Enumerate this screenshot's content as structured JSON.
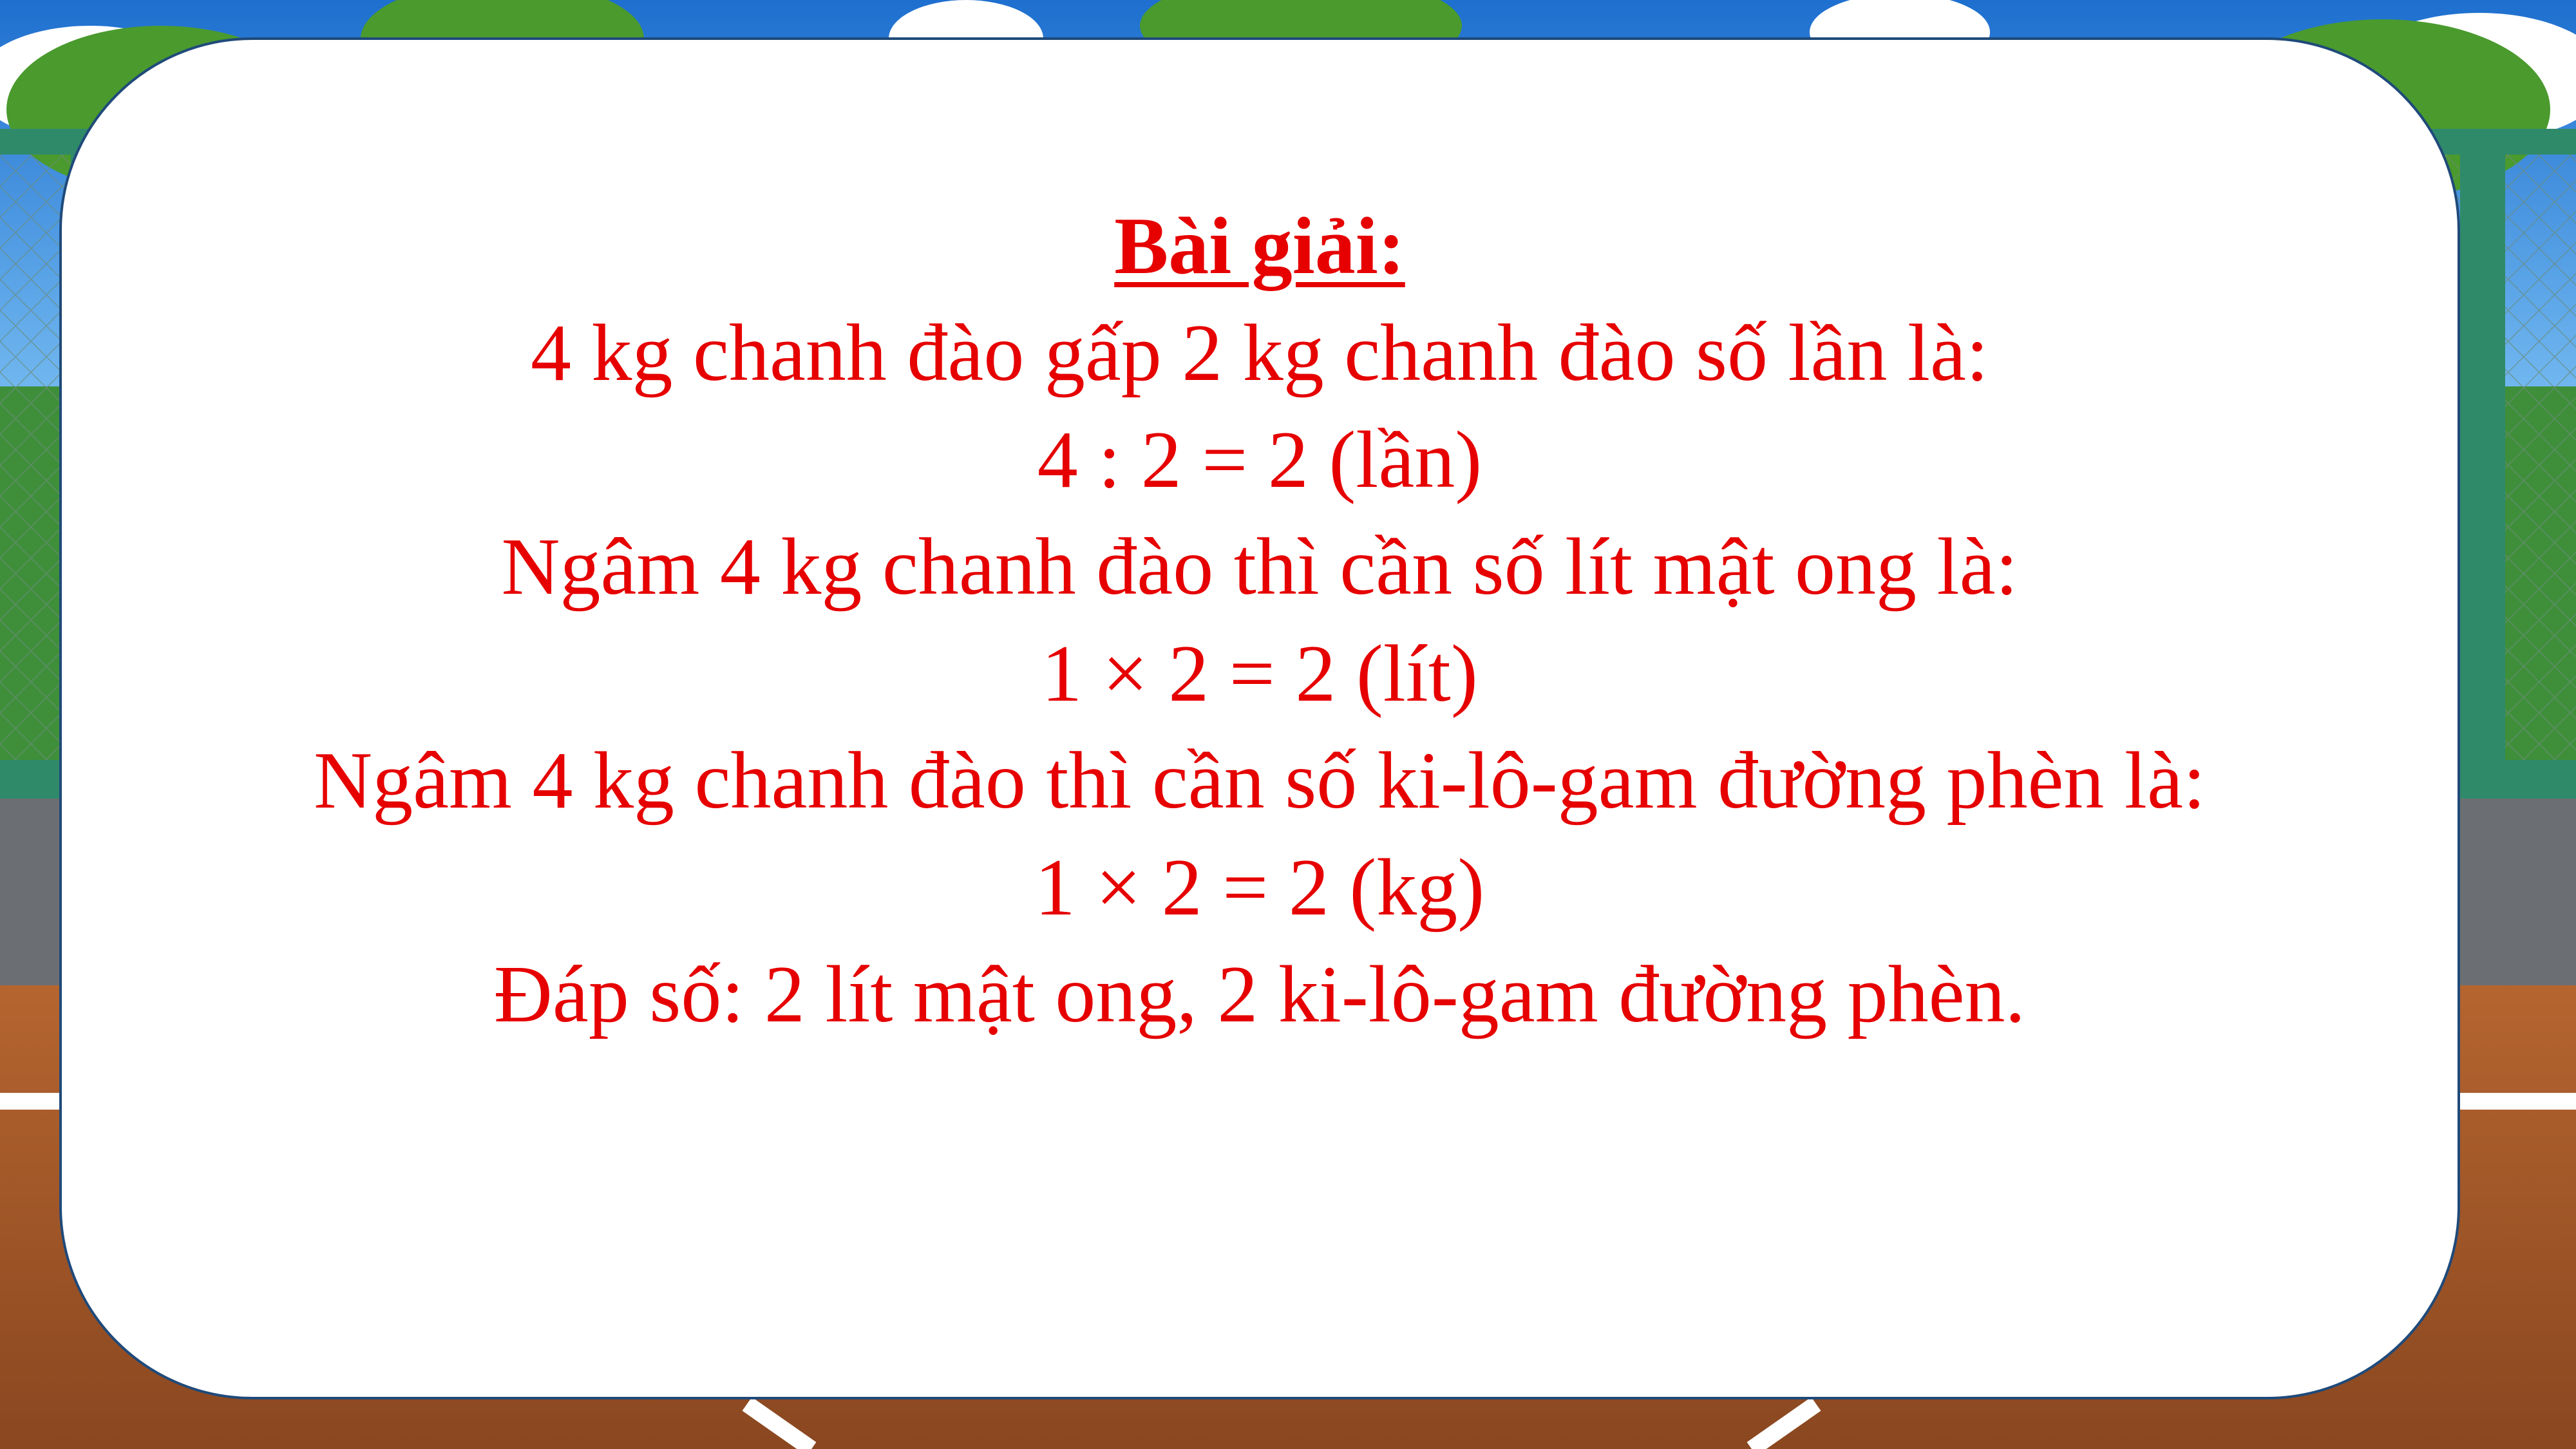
{
  "solution": {
    "heading": "Bài giải:",
    "lines": [
      "4 kg chanh đào gấp 2 kg chanh đào số lần là:",
      "4 : 2 = 2 (lần)",
      "Ngâm 4 kg chanh đào thì cần số lít mật ong là:",
      "1 × 2 = 2 (lít)",
      "Ngâm 4 kg chanh đào thì cần số ki-lô-gam đường phèn là:",
      "1 × 2 = 2 (kg)",
      "Đáp số: 2 lít mật ong, 2 ki-lô-gam đường phèn."
    ]
  },
  "colors": {
    "text": "#e60000",
    "card_border": "#1f4a7a",
    "sky": "#2e7fd6",
    "fence": "#2f8a6a",
    "court": "#a0522d"
  }
}
